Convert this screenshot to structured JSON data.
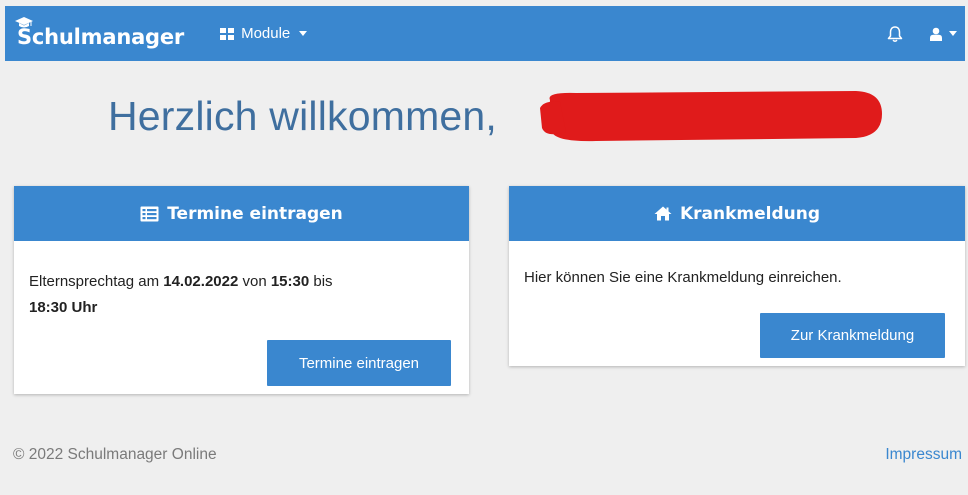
{
  "navbar": {
    "brand": "Schulmanager",
    "modules_label": "Module",
    "icons": {
      "brand": "graduation-cap-icon",
      "modules": "grid-icon",
      "notifications": "bell-icon",
      "user": "user-icon"
    }
  },
  "welcome": {
    "text": "Herzlich willkommen,"
  },
  "cards": [
    {
      "title": "Termine eintragen",
      "icon": "list-icon",
      "text_parts": [
        "Elternsprechtag am ",
        "14.02.2022",
        " von ",
        "15:30",
        " bis ",
        "18:30 Uhr"
      ],
      "button": "Termine eintragen"
    },
    {
      "title": "Krankmeldung",
      "icon": "home-icon",
      "text": "Hier können Sie eine Krankmeldung einreichen.",
      "button": "Zur Krankmeldung"
    }
  ],
  "footer": {
    "copyright": "© 2022 Schulmanager Online",
    "impressum": "Impressum"
  },
  "colors": {
    "primary": "#3a87cf",
    "heading": "#3f6f9f",
    "background": "#efefef",
    "redaction": "#e01b1b"
  }
}
